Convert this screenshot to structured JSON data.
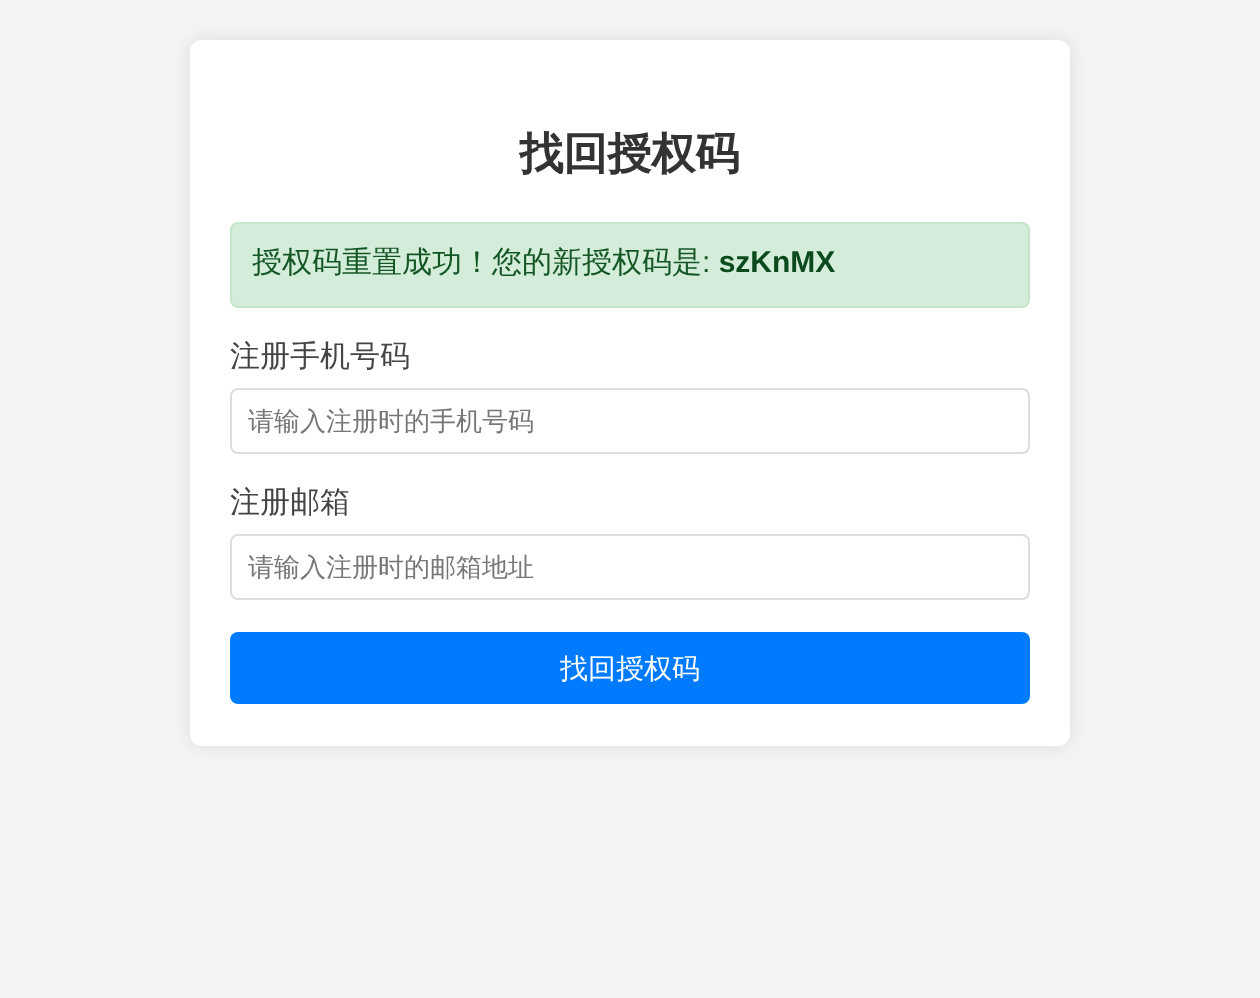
{
  "title": "找回授权码",
  "alert": {
    "message": "授权码重置成功！您的新授权码是: **szKnMX**"
  },
  "fields": [
    {
      "label": "注册手机号码",
      "placeholder": "请输入注册时的手机号码"
    },
    {
      "label": "注册邮箱",
      "placeholder": "请输入注册时的邮箱地址"
    }
  ],
  "submit_button": "找回授权码"
}
